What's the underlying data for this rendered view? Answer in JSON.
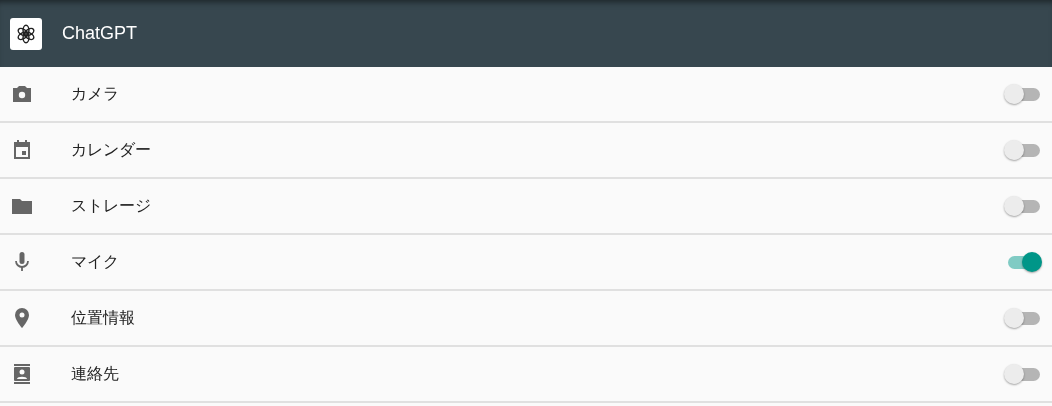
{
  "app_bar": {
    "title": "ChatGPT"
  },
  "permissions": [
    {
      "label": "カメラ",
      "on": false
    },
    {
      "label": "カレンダー",
      "on": false
    },
    {
      "label": "ストレージ",
      "on": false
    },
    {
      "label": "マイク",
      "on": true
    },
    {
      "label": "位置情報",
      "on": false
    },
    {
      "label": "連絡先",
      "on": false
    }
  ]
}
